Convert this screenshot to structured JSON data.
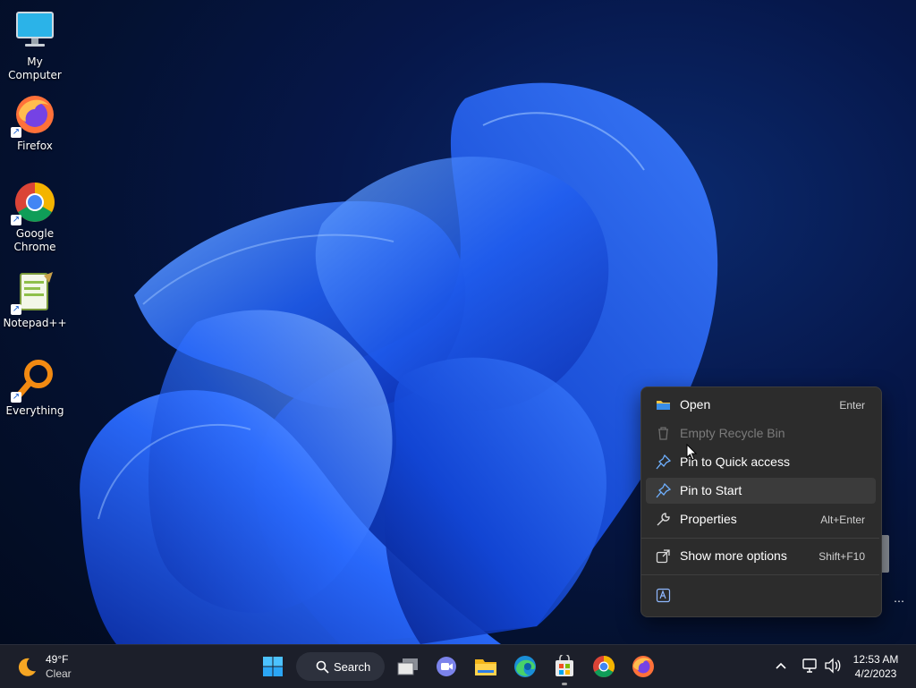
{
  "desktop": {
    "icons": [
      {
        "label": "My Computer",
        "icon": "monitor-icon"
      },
      {
        "label": "Firefox",
        "icon": "firefox-icon"
      },
      {
        "label": "Google Chrome",
        "icon": "chrome-icon"
      },
      {
        "label": "Notepad++",
        "icon": "notepadpp-icon"
      },
      {
        "label": "Everything",
        "icon": "everything-search-icon"
      }
    ]
  },
  "context_menu": {
    "items": [
      {
        "label": "Open",
        "shortcut": "Enter",
        "icon": "folder-icon",
        "enabled": true,
        "highlighted": false
      },
      {
        "label": "Empty Recycle Bin",
        "shortcut": "",
        "icon": "trash-icon",
        "enabled": false,
        "highlighted": false
      },
      {
        "label": "Pin to Quick access",
        "shortcut": "",
        "icon": "pin-icon",
        "enabled": true,
        "highlighted": false
      },
      {
        "label": "Pin to Start",
        "shortcut": "",
        "icon": "pin-icon",
        "enabled": true,
        "highlighted": true
      },
      {
        "label": "Properties",
        "shortcut": "Alt+Enter",
        "icon": "wrench-icon",
        "enabled": true,
        "highlighted": false
      },
      {
        "label": "Show more options",
        "shortcut": "Shift+F10",
        "icon": "external-options-icon",
        "enabled": true,
        "highlighted": false
      }
    ],
    "footer_icon": "text-edit-icon"
  },
  "taskbar": {
    "weather": {
      "temp": "49°F",
      "condition": "Clear",
      "icon": "moon-icon"
    },
    "search_label": "Search",
    "apps": [
      "windows-start-icon",
      "search-icon",
      "task-view-icon",
      "teams-chat-icon",
      "file-explorer-icon",
      "edge-icon",
      "store-icon",
      "chrome-icon",
      "firefox-icon"
    ],
    "tray": {
      "time": "12:53 AM",
      "date": "4/2/2023"
    }
  },
  "colors": {
    "menu_bg": "#2c2c2c",
    "menu_highlight": "#3b3b3b",
    "taskbar_bg": "#1c1f2a",
    "accent_blue": "#1f6feb"
  }
}
